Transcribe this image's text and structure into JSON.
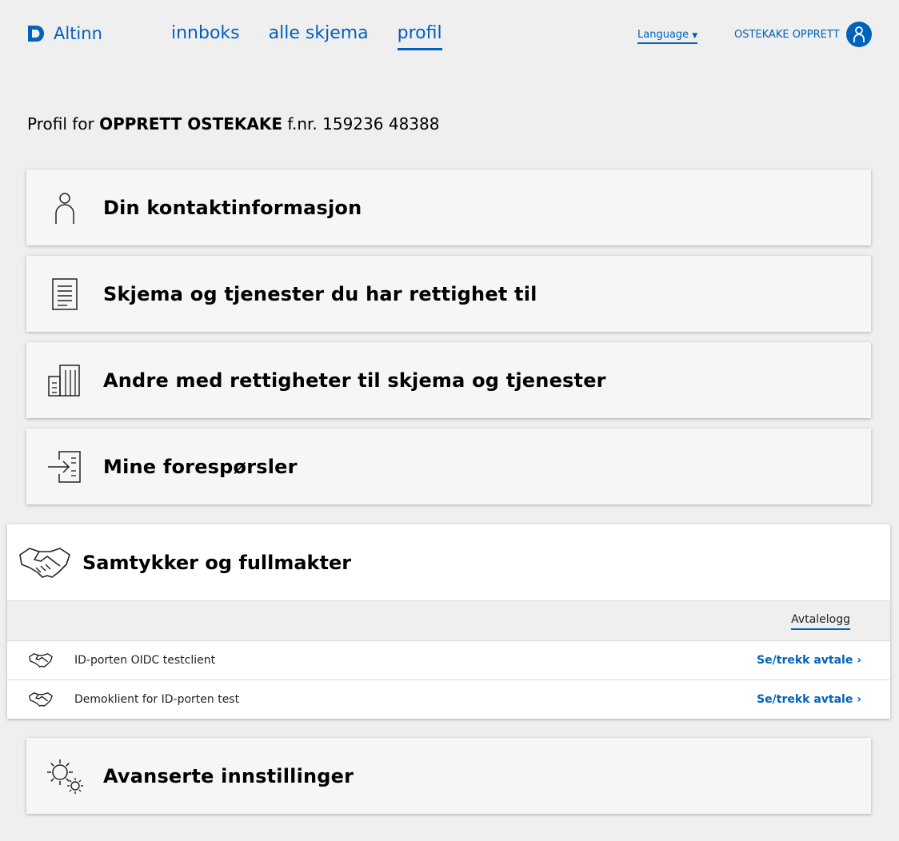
{
  "header": {
    "logo_text": "Altinn",
    "nav": [
      {
        "label": "innboks",
        "active": false
      },
      {
        "label": "alle skjema",
        "active": false
      },
      {
        "label": "profil",
        "active": true
      }
    ],
    "language_label": "Language",
    "user_name": "OSTEKAKE OPPRETT"
  },
  "profile": {
    "prefix": "Profil for",
    "name": "OPPRETT OSTEKAKE",
    "fnr_label": "f.nr.",
    "fnr": "159236 48388"
  },
  "sections": {
    "contact": "Din kontaktinformasjon",
    "forms": "Skjema og tjenester du har rettighet til",
    "others": "Andre med rettigheter til skjema og tjenester",
    "requests": "Mine forespørsler",
    "consents": "Samtykker og fullmakter",
    "advanced": "Avanserte innstillinger"
  },
  "consents": {
    "log_label": "Avtalelogg",
    "items": [
      {
        "name": "ID-porten OIDC testclient",
        "action": "Se/trekk avtale ›"
      },
      {
        "name": "Demoklient for ID-porten test",
        "action": "Se/trekk avtale ›"
      }
    ]
  },
  "colors": {
    "brand": "#0062ba",
    "background": "#efefef"
  }
}
